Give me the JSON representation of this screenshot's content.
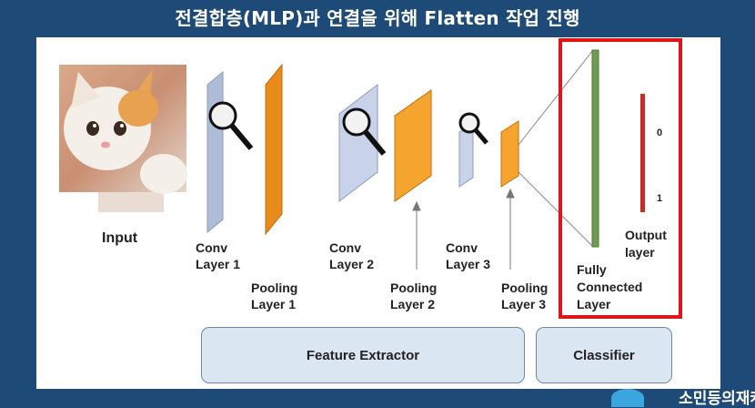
{
  "title": "전결합층(MLP)과 연결을 위해 Flatten 작업 진행",
  "labels": {
    "input": "Input",
    "conv1": [
      "Conv",
      "Layer 1"
    ],
    "pool1": [
      "Pooling",
      "Layer 1"
    ],
    "conv2": [
      "Conv",
      "Layer 2"
    ],
    "pool2": [
      "Pooling",
      "Layer 2"
    ],
    "conv3": [
      "Conv",
      "Layer 3"
    ],
    "pool3": [
      "Pooling",
      "Layer 3"
    ],
    "fc": [
      "Fully",
      "Connected",
      "Layer"
    ],
    "output": [
      "Output",
      "layer"
    ],
    "out0": "0",
    "out1": "1"
  },
  "boxes": {
    "feature_extractor": "Feature Extractor",
    "classifier": "Classifier"
  },
  "footer": "소민등의재캐",
  "colors": {
    "background": "#1e4a78",
    "conv": "#aebcd8",
    "pool": "#e88a1c",
    "fc": "#6f9b52",
    "output": "#c92a2a",
    "highlight": "#e0151b"
  }
}
